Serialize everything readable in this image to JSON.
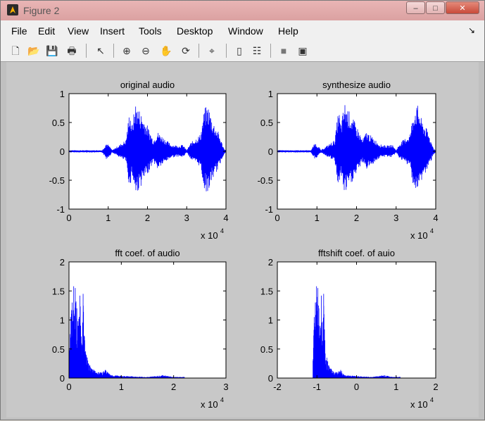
{
  "window": {
    "title": "Figure 2",
    "minimize_glyph": "‒",
    "maximize_glyph": "□",
    "close_glyph": "✕"
  },
  "menu": [
    "File",
    "Edit",
    "View",
    "Insert",
    "Tools",
    "Desktop",
    "Window",
    "Help"
  ],
  "menu_arrow_glyph": "↘",
  "toolbar_icons": [
    "new-figure-icon",
    "open-file-icon",
    "save-icon",
    "print-icon",
    "pointer-icon",
    "zoom-in-icon",
    "zoom-out-icon",
    "pan-icon",
    "rotate-3d-icon",
    "data-cursor-icon",
    "colorbar-icon",
    "legend-icon",
    "hide-plot-tools-icon",
    "show-plot-tools-icon"
  ],
  "colors": {
    "line": "#0000ff",
    "figure_bg": "#c8c8c8",
    "axes_bg": "#ffffff"
  },
  "chart_data": [
    {
      "type": "line",
      "title": "original audio",
      "xlim": [
        0,
        40000
      ],
      "ylim": [
        -1,
        1
      ],
      "xticks": [
        0,
        10000,
        20000,
        30000,
        40000
      ],
      "xtick_labels": [
        "0",
        "1",
        "2",
        "3",
        "4"
      ],
      "yticks": [
        -1,
        -0.5,
        0,
        0.5,
        1
      ],
      "ytick_labels": [
        "-1",
        "-0.5",
        "0",
        "0.5",
        "1"
      ],
      "xexponent": "x 10",
      "xexponent_power": "4",
      "envelope": {
        "x": [
          0,
          8500,
          9500,
          10500,
          11000,
          14500,
          15500,
          16000,
          17000,
          18500,
          20000,
          21500,
          22500,
          24000,
          26000,
          28000,
          29000,
          30000,
          31000,
          33500,
          34500,
          35500,
          36500,
          38000,
          39500,
          40000
        ],
        "amp": [
          0.02,
          0.02,
          0.15,
          0.08,
          0.02,
          0.2,
          0.75,
          0.45,
          0.85,
          0.65,
          0.45,
          0.2,
          0.35,
          0.25,
          0.12,
          0.1,
          0.12,
          0.02,
          0.15,
          0.3,
          0.75,
          0.8,
          0.55,
          0.35,
          0.05,
          0.02
        ]
      }
    },
    {
      "type": "line",
      "title": "synthesize audio",
      "xlim": [
        0,
        40000
      ],
      "ylim": [
        -1,
        1
      ],
      "xticks": [
        0,
        10000,
        20000,
        30000,
        40000
      ],
      "xtick_labels": [
        "0",
        "1",
        "2",
        "3",
        "4"
      ],
      "yticks": [
        -1,
        -0.5,
        0,
        0.5,
        1
      ],
      "ytick_labels": [
        "-1",
        "-0.5",
        "0",
        "0.5",
        "1"
      ],
      "xexponent": "x 10",
      "xexponent_power": "4",
      "envelope": {
        "x": [
          0,
          8500,
          9500,
          10500,
          11000,
          14500,
          15500,
          16000,
          17000,
          18500,
          20000,
          21500,
          22500,
          24000,
          26000,
          28000,
          29000,
          30000,
          31000,
          33500,
          34500,
          35500,
          36500,
          38000,
          39500,
          40000
        ],
        "amp": [
          0.02,
          0.02,
          0.15,
          0.08,
          0.02,
          0.2,
          0.75,
          0.45,
          0.85,
          0.65,
          0.45,
          0.2,
          0.35,
          0.25,
          0.12,
          0.1,
          0.12,
          0.02,
          0.15,
          0.3,
          0.75,
          0.8,
          0.55,
          0.35,
          0.05,
          0.02
        ]
      }
    },
    {
      "type": "bar",
      "title": "fft coef. of audio",
      "xlim": [
        0,
        30000
      ],
      "ylim": [
        0,
        2
      ],
      "xticks": [
        0,
        10000,
        20000,
        30000
      ],
      "xtick_labels": [
        "0",
        "1",
        "2",
        "3"
      ],
      "yticks": [
        0,
        0.5,
        1,
        1.5,
        2
      ],
      "ytick_labels": [
        "0",
        "0.5",
        "1",
        "1.5",
        "2"
      ],
      "xexponent": "x 10",
      "xexponent_power": "4",
      "spectrum": {
        "x": [
          0,
          300,
          600,
          900,
          1200,
          1500,
          1800,
          2100,
          2400,
          2700,
          3000,
          3500,
          4000,
          5000,
          6000,
          7000,
          8000,
          10000,
          12000,
          15000,
          18000,
          20000,
          22000,
          22300
        ],
        "y": [
          0.3,
          1.05,
          1.3,
          1.58,
          1.55,
          1.2,
          0.9,
          1.42,
          0.55,
          1.45,
          0.65,
          0.35,
          0.22,
          0.12,
          0.1,
          0.14,
          0.05,
          0.04,
          0.03,
          0.02,
          0.05,
          0.02,
          0.02,
          0
        ]
      }
    },
    {
      "type": "bar",
      "title": "fftshift coef. of auio",
      "xlim": [
        -20000,
        20000
      ],
      "ylim": [
        0,
        2
      ],
      "xticks": [
        -20000,
        -10000,
        0,
        10000,
        20000
      ],
      "xtick_labels": [
        "-2",
        "-1",
        "0",
        "1",
        "2"
      ],
      "yticks": [
        0,
        0.5,
        1,
        1.5,
        2
      ],
      "ytick_labels": [
        "0",
        "0.5",
        "1",
        "1.5",
        "2"
      ],
      "xexponent": "x 10",
      "xexponent_power": "4",
      "spectrum": {
        "x": [
          -11000,
          -10700,
          -10400,
          -10100,
          -9800,
          -9500,
          -9200,
          -8900,
          -8600,
          -8300,
          -8000,
          -7500,
          -7000,
          -6000,
          -5000,
          -4000,
          -3000,
          -1000,
          1000,
          4000,
          7000,
          9000,
          11000,
          11300
        ],
        "y": [
          0.3,
          1.05,
          1.3,
          1.58,
          1.55,
          1.2,
          0.9,
          1.42,
          0.55,
          1.45,
          0.65,
          0.35,
          0.22,
          0.12,
          0.1,
          0.14,
          0.05,
          0.04,
          0.03,
          0.02,
          0.05,
          0.02,
          0.02,
          0
        ]
      }
    }
  ]
}
